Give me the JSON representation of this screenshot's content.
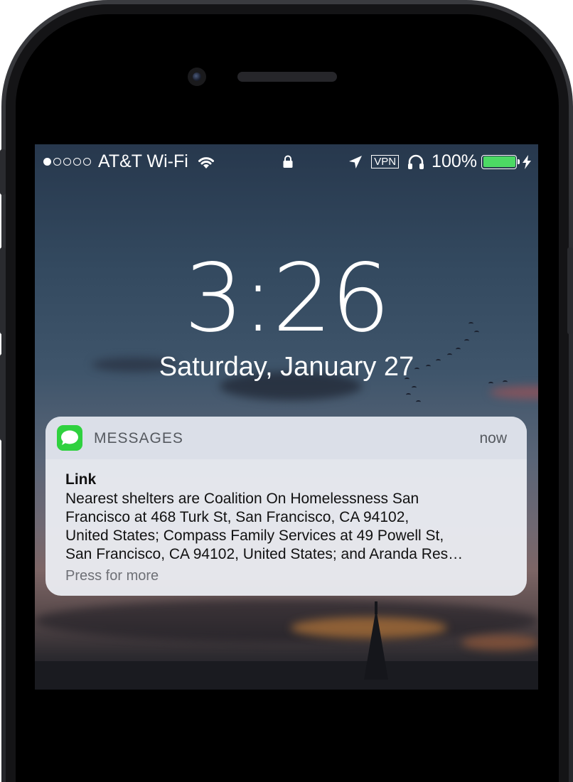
{
  "status_bar": {
    "carrier": "AT&T Wi-Fi",
    "signal_strength": 1,
    "signal_max": 5,
    "vpn_label": "VPN",
    "battery_percent": "100%",
    "battery_level": 1.0,
    "icons": [
      "wifi-icon",
      "lock-icon",
      "location-icon",
      "headphones-icon",
      "battery-icon",
      "charging-bolt-icon"
    ]
  },
  "lock_screen": {
    "time": "3:26",
    "date": "Saturday, January 27"
  },
  "notification": {
    "app_name": "MESSAGES",
    "timestamp": "now",
    "sender": "Link",
    "body_lines": [
      "Nearest shelters are Coalition On Homelessness San",
      "Francisco at 468 Turk St, San Francisco, CA 94102,",
      "United States; Compass Family Services at 49 Powell St,",
      "San Francisco, CA 94102, United States; and Aranda Res…"
    ],
    "hint": "Press for more",
    "app_icon": "messages-icon"
  },
  "colors": {
    "battery_green": "#4cd964",
    "messages_green": "#1fc92e"
  }
}
